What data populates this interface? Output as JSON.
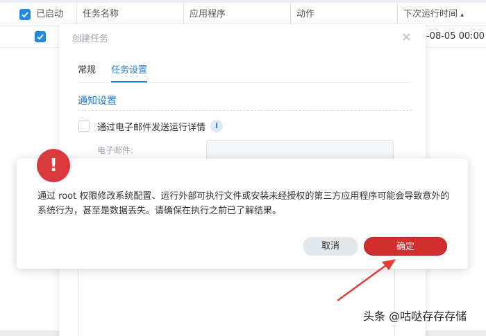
{
  "table": {
    "columns": [
      "已启动",
      "任务名称",
      "应用程序",
      "动作",
      "下次运行时间"
    ],
    "sort_indicator": "▴",
    "row": {
      "enabled": true,
      "next_run": "-08-05 00:00"
    }
  },
  "task_dialog": {
    "title": "创建任务",
    "close": "×",
    "tabs": [
      "常规",
      "任务设置"
    ],
    "active_tab": "任务设置",
    "section_title": "通知设置",
    "email_checkbox_label": "通过电子邮件发送运行详情",
    "info_icon": "i",
    "email_field_label": "电子邮件:",
    "email_value": ""
  },
  "warning": {
    "icon": "!",
    "message": "通过 root 权限修改系统配置、运行外部可执行文件或安装未经授权的第三方应用程序可能会导致意外的系统行为，甚至是数据丢失。请确保在执行之前已了解结果。",
    "cancel_label": "取消",
    "ok_label": "确定",
    "accent": "#d12e2e"
  },
  "watermark": "头条 @咕哒存存存储"
}
